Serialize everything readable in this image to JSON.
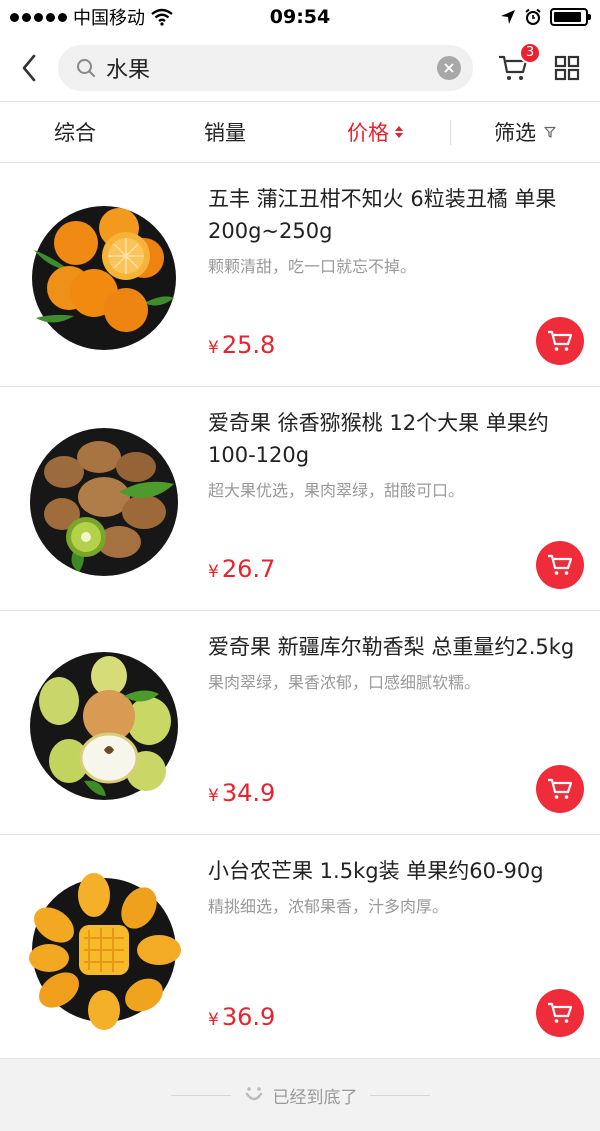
{
  "status_bar": {
    "carrier": "中国移动",
    "time": "09:54",
    "battery_level": 0.9
  },
  "header": {
    "back_icon": "chevron-left-icon",
    "search_value": "水果",
    "search_icon": "search-icon",
    "clear_icon": "clear-icon",
    "cart_count": "3",
    "grid_icon": "grid-icon"
  },
  "sort_bar": {
    "items": [
      {
        "label": "综合"
      },
      {
        "label": "销量"
      },
      {
        "label": "价格"
      },
      {
        "label": "筛选"
      }
    ],
    "active": "价格"
  },
  "products": [
    {
      "title": "五丰 蒲江丑柑不知火 6粒装丑橘 单果200g~250g",
      "desc": "颗颗清甜，吃一口就忘不掉。",
      "currency": "¥",
      "price": "25.8",
      "image": "tangerine-plate"
    },
    {
      "title": "爱奇果 徐香猕猴桃 12个大果 单果约100-120g",
      "desc": "超大果优选，果肉翠绿，甜酸可口。",
      "currency": "¥",
      "price": "26.7",
      "image": "kiwi-plate"
    },
    {
      "title": "爱奇果 新疆库尔勒香梨 总重量约2.5kg",
      "desc": "果肉翠绿，果香浓郁，口感细腻软糯。",
      "currency": "¥",
      "price": "34.9",
      "image": "pear-plate"
    },
    {
      "title": "小台农芒果 1.5kg装 单果约60-90g",
      "desc": "精挑细选，浓郁果香，汁多肉厚。",
      "currency": "¥",
      "price": "36.9",
      "image": "mango-plate"
    }
  ],
  "footer": {
    "end_text": "已经到底了"
  },
  "colors": {
    "accent": "#e8222e",
    "muted": "#999999",
    "border": "#e6e6e6"
  }
}
